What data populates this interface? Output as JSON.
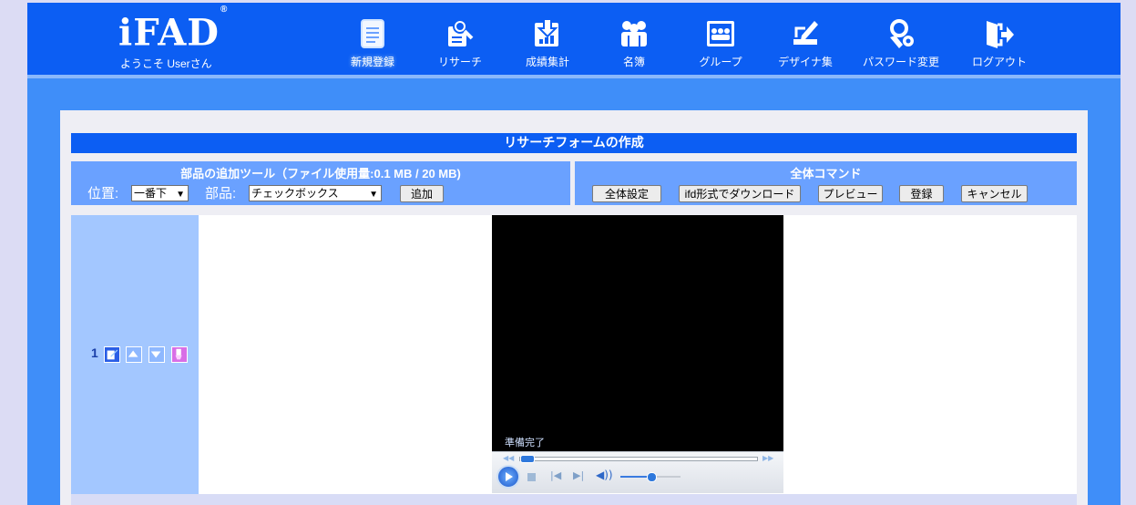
{
  "header": {
    "logo": "iFAD",
    "logo_mark": "®",
    "welcome": "ようこそ Userさん",
    "nav": [
      {
        "label": "新規登録",
        "icon": "document-icon",
        "active": true
      },
      {
        "label": "リサーチ",
        "icon": "research-icon",
        "active": false
      },
      {
        "label": "成績集計",
        "icon": "tally-icon",
        "active": false
      },
      {
        "label": "名簿",
        "icon": "roster-icon",
        "active": false
      },
      {
        "label": "グループ",
        "icon": "group-icon",
        "active": false
      },
      {
        "label": "デザイナ集",
        "icon": "designer-icon",
        "active": false
      },
      {
        "label": "パスワード変更",
        "icon": "password-icon",
        "active": false
      },
      {
        "label": "ログアウト",
        "icon": "logout-icon",
        "active": false
      }
    ]
  },
  "form": {
    "title": "リサーチフォームの作成",
    "tools": {
      "title": "部品の追加ツール（ファイル使用量:0.1 MB / 20 MB)",
      "position_label": "位置:",
      "position_value": "一番下",
      "part_label": "部品:",
      "part_value": "チェックボックス",
      "add_button": "追加"
    },
    "commands": {
      "title": "全体コマンド",
      "buttons": [
        "全体設定",
        "ifd形式でダウンロード",
        "プレビュー",
        "登録",
        "キャンセル"
      ]
    }
  },
  "row": {
    "number": "1",
    "controls": [
      "edit-icon",
      "move-up-icon",
      "move-down-icon",
      "delete-icon"
    ]
  },
  "player": {
    "status": "準備完了",
    "volume_level": 0.5,
    "progress": 0.0
  },
  "colors": {
    "header_bg": "#0c5ef3",
    "frame_bg": "#3f8ef9",
    "panel_bg": "#6aa1ff",
    "row_side_bg": "#a3c7ff"
  }
}
